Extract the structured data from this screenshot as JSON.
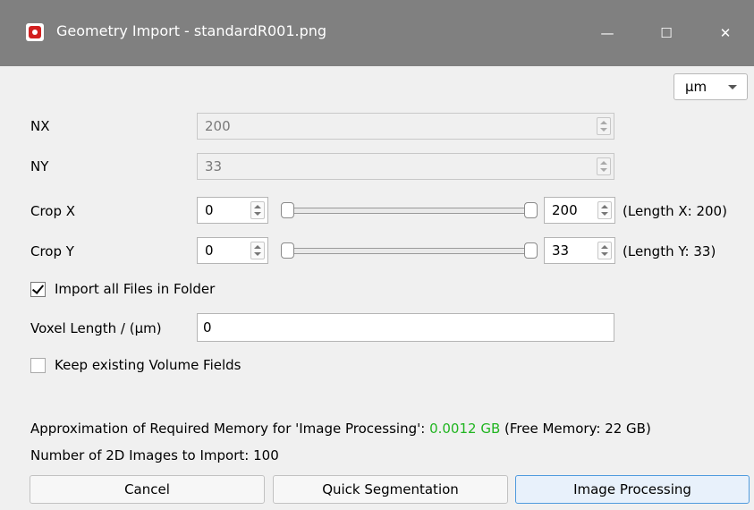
{
  "window": {
    "title": "Geometry Import - standardR001.png",
    "controls": {
      "minimize": "—",
      "maximize": "☐",
      "close": "✕"
    },
    "app_icon": "app-logo-icon"
  },
  "unit_select": {
    "value": "μm",
    "icon": "chevron-down-icon"
  },
  "nx": {
    "label": "NX",
    "value": "200"
  },
  "ny": {
    "label": "NY",
    "value": "33"
  },
  "crop_x": {
    "label": "Crop X",
    "min": "0",
    "max": "200",
    "length_text": "(Length X: 200)",
    "range": [
      0,
      200
    ],
    "limits": [
      0,
      200
    ]
  },
  "crop_y": {
    "label": "Crop Y",
    "min": "0",
    "max": "33",
    "length_text": "(Length Y: 33)",
    "range": [
      0,
      33
    ],
    "limits": [
      0,
      33
    ]
  },
  "import_all": {
    "label": "Import all Files in Folder",
    "checked": true
  },
  "voxel_length": {
    "label": "Voxel Length / (μm)",
    "value": "0"
  },
  "keep_fields": {
    "label": "Keep existing Volume Fields",
    "checked": false
  },
  "memory": {
    "prefix": "Approximation of Required Memory for 'Image Processing':",
    "value": "0.0012 GB",
    "suffix": "(Free Memory: 22 GB)",
    "value_color": "#21b521"
  },
  "images_count_text": "Number of 2D Images to Import: 100",
  "buttons": {
    "cancel": "Cancel",
    "quick": "Quick Segmentation",
    "process": "Image Processing"
  },
  "colors": {
    "titlebar": "#808080",
    "accent": "#4f9bde",
    "background": "#f0f0f0"
  }
}
